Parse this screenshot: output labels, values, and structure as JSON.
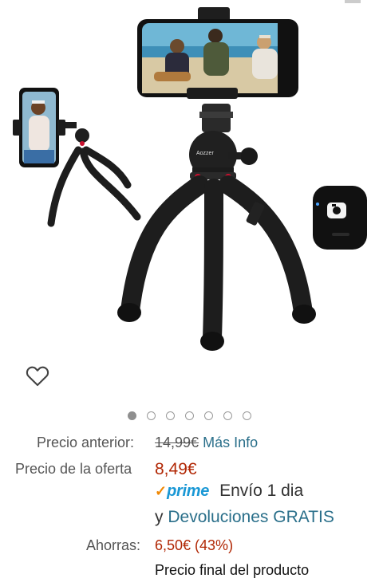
{
  "gallery": {
    "wishlist_icon": "heart-outline-icon",
    "image_count": 7,
    "active_index": 0,
    "brand_mark": "Aozzer",
    "remote_icon": "camera-icon"
  },
  "pricing": {
    "previous_label": "Precio anterior:",
    "previous_price": "14,99€",
    "more_info": "Más Info",
    "deal_label": "Precio de la oferta",
    "deal_price": "8,49€",
    "prime_check": "✓",
    "prime_word": "prime",
    "shipping": "Envío 1 dia",
    "returns_prefix": "y",
    "returns_link": "Devoluciones GRATIS",
    "savings_label": "Ahorras:",
    "savings_value": "6,50€ (43%)",
    "final_note": "Precio final del producto"
  },
  "colors": {
    "deal_red": "#b12704",
    "link_teal": "#2a6f8a",
    "prime_blue": "#1a98d5",
    "prime_orange": "#f08804"
  }
}
